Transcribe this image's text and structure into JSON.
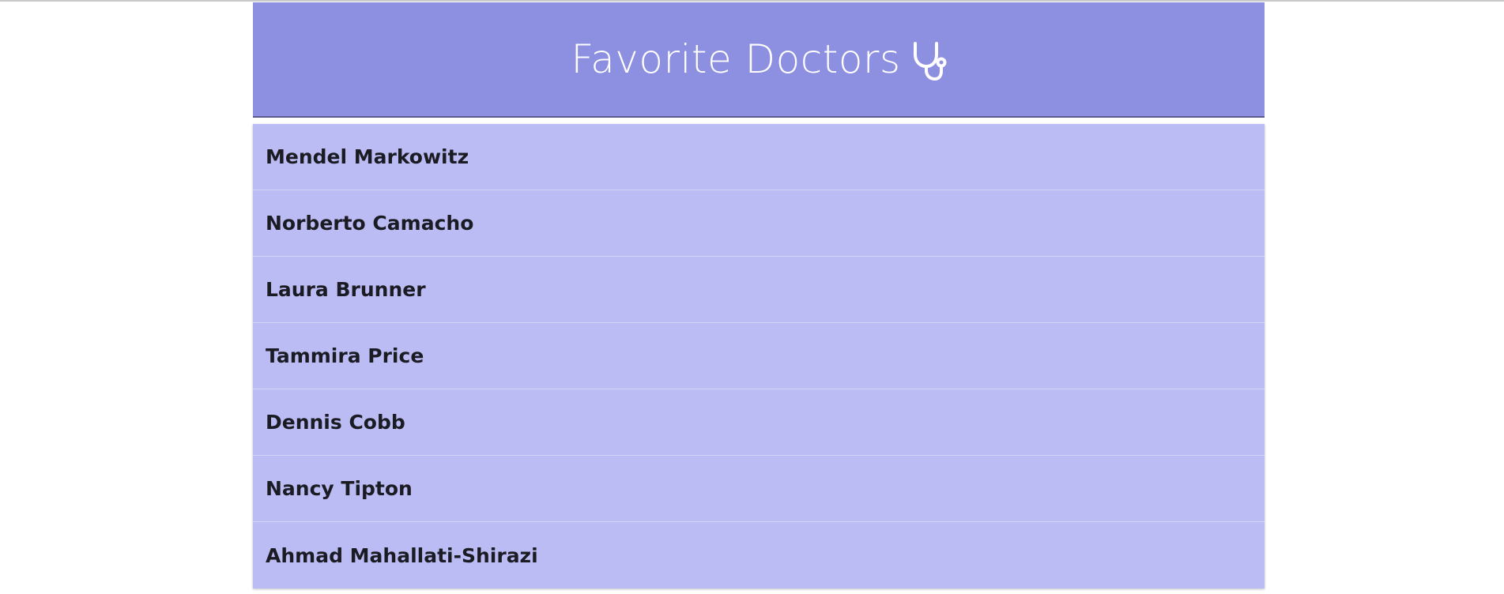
{
  "header": {
    "title": "Favorite Doctors",
    "icon": "stethoscope-icon"
  },
  "doctors": [
    {
      "name": "Mendel Markowitz"
    },
    {
      "name": "Norberto Camacho"
    },
    {
      "name": "Laura Brunner"
    },
    {
      "name": "Tammira Price"
    },
    {
      "name": "Dennis Cobb"
    },
    {
      "name": "Nancy Tipton"
    },
    {
      "name": "Ahmad Mahallati-Shirazi"
    }
  ],
  "colors": {
    "header_bg": "#8d8fe0",
    "header_border": "#595b8f",
    "list_bg": "#bcbcf5",
    "text_dark": "#1b1b24",
    "header_text": "#ffffff"
  }
}
